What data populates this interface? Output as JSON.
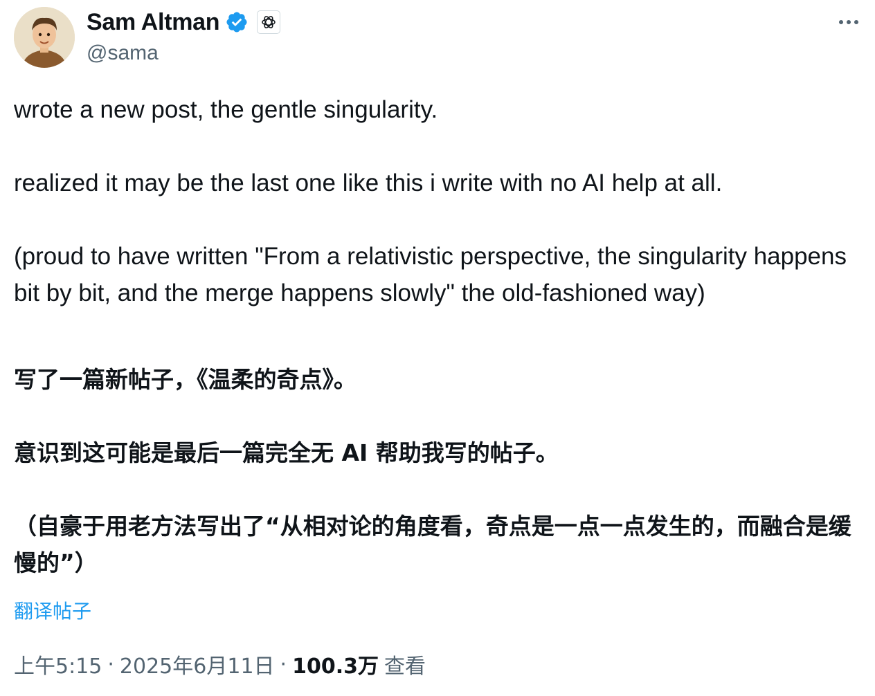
{
  "author": {
    "display_name": "Sam Altman",
    "handle": "@sama",
    "verified_color": "#1d9bf0"
  },
  "tweet": {
    "en_paragraphs": [
      "wrote a new post, the gentle singularity.",
      "realized it may be the last one like this i write with no AI help at all.",
      "(proud to have written \"From a relativistic perspective, the singularity happens bit by bit, and the merge happens slowly\" the old-fashioned way)"
    ],
    "zh_paragraphs": [
      "写了一篇新帖子，《温柔的奇点》。",
      "意识到这可能是最后一篇完全无 AI 帮助我写的帖子。",
      "（自豪于用老方法写出了“从相对论的角度看，奇点是一点一点发生的，而融合是缓慢的”）"
    ],
    "translate_label": "翻译帖子"
  },
  "meta": {
    "time": "上午5:15",
    "sep1": "·",
    "date": "2025年6月11日",
    "sep2": "·",
    "views_count": "100.3万",
    "views_label": "查看"
  },
  "icons": {
    "avatar": "avatar-illustration",
    "verified": "verified-badge-icon",
    "affiliation": "openai-logo-icon",
    "more": "more-options-icon"
  }
}
